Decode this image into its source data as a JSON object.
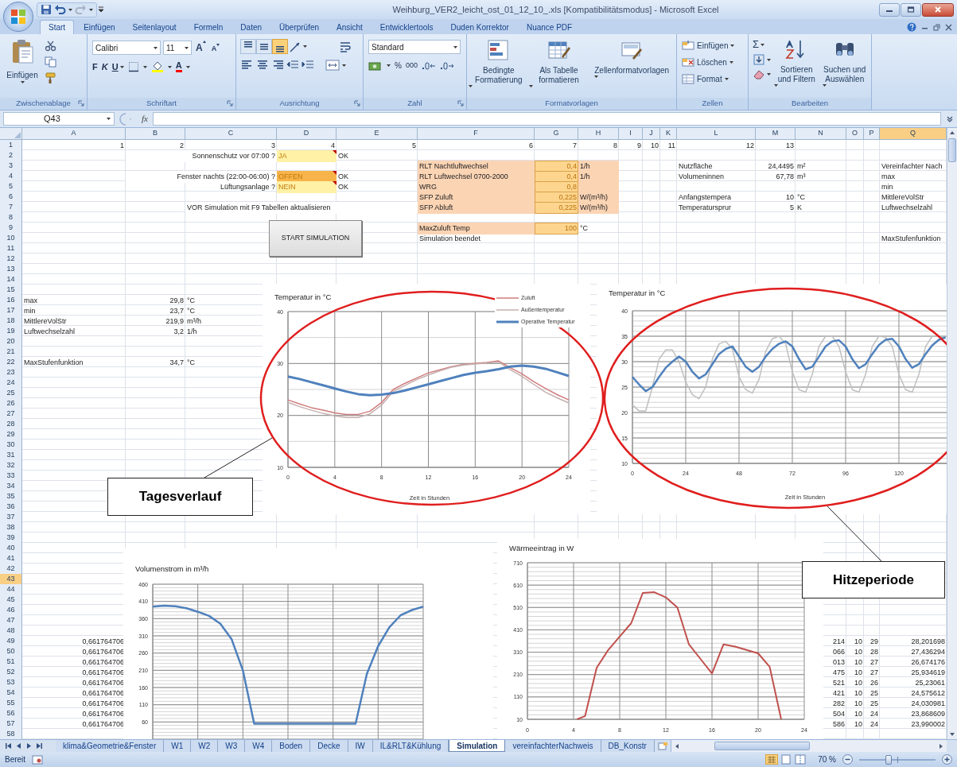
{
  "window": {
    "title": "Weihburg_VER2_leicht_ost_01_12_10_.xls  [Kompatibilitätsmodus] - Microsoft Excel"
  },
  "ribbon_tabs": [
    {
      "label": "Start",
      "selected": true
    },
    {
      "label": "Einfügen",
      "selected": false
    },
    {
      "label": "Seitenlayout",
      "selected": false
    },
    {
      "label": "Formeln",
      "selected": false
    },
    {
      "label": "Daten",
      "selected": false
    },
    {
      "label": "Überprüfen",
      "selected": false
    },
    {
      "label": "Ansicht",
      "selected": false
    },
    {
      "label": "Entwicklertools",
      "selected": false
    },
    {
      "label": "Duden Korrektor",
      "selected": false
    },
    {
      "label": "Nuance PDF",
      "selected": false
    }
  ],
  "ribbon": {
    "clipboard": {
      "label": "Zwischenablage",
      "paste": "Einfügen"
    },
    "font": {
      "label": "Schriftart",
      "font_name": "Calibri",
      "font_size": "11",
      "grow": "A",
      "shrink": "A",
      "bold": "F",
      "italic": "K",
      "underline": "U",
      "color_letter": "A"
    },
    "alignment": {
      "label": "Ausrichtung",
      "vertical": [
        {
          "kind": "top",
          "on": false
        },
        {
          "kind": "middle",
          "on": false
        },
        {
          "kind": "bottom",
          "on": true
        }
      ]
    },
    "number": {
      "label": "Zahl",
      "format": "Standard",
      "percent": "%",
      "thousands": "000"
    },
    "styles": {
      "label": "Formatvorlagen",
      "buttons": [
        "Bedingte Formatierung",
        "Als Tabelle formatieren",
        "Zellenformatvorlagen"
      ]
    },
    "cells": {
      "label": "Zellen",
      "buttons": [
        "Einfügen",
        "Löschen",
        "Format"
      ]
    },
    "editing": {
      "label": "Bearbeiten",
      "sum": "Σ",
      "buttons": [
        "Sortieren und Filtern",
        "Suchen und Auswählen"
      ]
    }
  },
  "formula_bar": {
    "name_box": "Q43",
    "fx": "fx"
  },
  "columns": [
    {
      "label": "A",
      "selected": false
    },
    {
      "label": "B",
      "selected": false
    },
    {
      "label": "C",
      "selected": false
    },
    {
      "label": "D",
      "selected": false
    },
    {
      "label": "E",
      "selected": false
    },
    {
      "label": "F",
      "selected": false
    },
    {
      "label": "G",
      "selected": false
    },
    {
      "label": "H",
      "selected": false
    },
    {
      "label": "I",
      "selected": false
    },
    {
      "label": "J",
      "selected": false
    },
    {
      "label": "K",
      "selected": false
    },
    {
      "label": "L",
      "selected": false
    },
    {
      "label": "M",
      "selected": false
    },
    {
      "label": "N",
      "selected": false
    },
    {
      "label": "O",
      "selected": false
    },
    {
      "label": "P",
      "selected": false
    },
    {
      "label": "Q",
      "selected": true
    }
  ],
  "rows": [
    {
      "number": "1",
      "selected": false,
      "cells": {
        "A": {
          "text": "1",
          "kind": "number"
        },
        "B": {
          "text": "2",
          "kind": "number"
        },
        "C": {
          "text": "3",
          "kind": "number"
        },
        "D": {
          "text": "4",
          "kind": "number"
        },
        "E": {
          "text": "5",
          "kind": "number"
        },
        "F": {
          "text": "6",
          "kind": "number"
        },
        "G": {
          "text": "7",
          "kind": "number"
        },
        "H": {
          "text": "8",
          "kind": "number"
        },
        "I": {
          "text": "9",
          "kind": "number"
        },
        "J": {
          "text": "10",
          "kind": "number"
        },
        "K": {
          "text": "11",
          "kind": "number"
        },
        "L": {
          "text": "12",
          "kind": "number"
        },
        "M": {
          "text": "13",
          "kind": "number"
        }
      }
    },
    {
      "number": "2",
      "selected": false,
      "cells": {
        "C": {
          "text": "Sonnenschutz vor 07:00 ?",
          "kind": "label"
        },
        "D": {
          "text": "JA",
          "kind": "choice",
          "color": "#fff1a6"
        },
        "E": {
          "text": "OK",
          "kind": "text"
        }
      }
    },
    {
      "number": "3",
      "selected": false,
      "cells": {
        "F": {
          "text": "RLT Nachtluftwechsel",
          "kind": "param"
        },
        "G": {
          "text": "0,4",
          "kind": "value"
        },
        "H": {
          "text": "1/h",
          "kind": "param"
        },
        "L": {
          "text": "Nutzfläche",
          "kind": "text"
        },
        "M": {
          "text": "24,4495",
          "kind": "number"
        },
        "N": {
          "text": "m²",
          "kind": "text"
        },
        "Q": {
          "text": "Vereinfachter Nach",
          "kind": "text"
        }
      }
    },
    {
      "number": "4",
      "selected": false,
      "cells": {
        "C": {
          "text": "Fenster nachts (22:00-06:00) ?",
          "kind": "label"
        },
        "D": {
          "text": "OFFEN",
          "kind": "choice",
          "color": "#f7b44a"
        },
        "E": {
          "text": "OK",
          "kind": "text"
        },
        "F": {
          "text": "RLT Luftwechsel 0700-2000",
          "kind": "param"
        },
        "G": {
          "text": "0,4",
          "kind": "value"
        },
        "H": {
          "text": "1/h",
          "kind": "param"
        },
        "L": {
          "text": "Volumeninnen",
          "kind": "text"
        },
        "M": {
          "text": "67,78",
          "kind": "number"
        },
        "N": {
          "text": "m³",
          "kind": "text"
        },
        "Q": {
          "text": "max",
          "kind": "text"
        }
      }
    },
    {
      "number": "5",
      "selected": false,
      "cells": {
        "C": {
          "text": "Lüftungsanlage ?",
          "kind": "label"
        },
        "D": {
          "text": "NEIN",
          "kind": "choice",
          "color": "#fff1a6"
        },
        "E": {
          "text": "OK",
          "kind": "text"
        },
        "F": {
          "text": "WRG",
          "kind": "param"
        },
        "G": {
          "text": "0,8",
          "kind": "value"
        },
        "H": {
          "kind": "param"
        },
        "Q": {
          "text": "min",
          "kind": "text"
        }
      }
    },
    {
      "number": "6",
      "selected": false,
      "cells": {
        "F": {
          "text": "SFP Zuluft",
          "kind": "param"
        },
        "G": {
          "text": "0,225",
          "kind": "value"
        },
        "H": {
          "text": "W/(m³/h)",
          "kind": "param"
        },
        "L": {
          "text": "Anfangstempera",
          "kind": "text"
        },
        "M": {
          "text": "10",
          "kind": "number"
        },
        "N": {
          "text": "°C",
          "kind": "text"
        },
        "Q": {
          "text": "MittlereVolStr",
          "kind": "text"
        }
      }
    },
    {
      "number": "7",
      "selected": false,
      "cells": {
        "C": {
          "text": "VOR Simulation mit F9 Tabellen aktualisieren",
          "kind": "text"
        },
        "F": {
          "text": "SFP Abluft",
          "kind": "param"
        },
        "G": {
          "text": "0,225",
          "kind": "value"
        },
        "H": {
          "text": "W/(m³/h)",
          "kind": "param"
        },
        "L": {
          "text": "Temperatursprur",
          "kind": "text"
        },
        "M": {
          "text": "5",
          "kind": "number"
        },
        "N": {
          "text": "K",
          "kind": "text"
        },
        "Q": {
          "text": "Luftwechselzahl",
          "kind": "text"
        }
      }
    },
    {
      "number": "8",
      "selected": false
    },
    {
      "number": "9",
      "selected": false,
      "cells": {
        "F": {
          "text": "MaxZuluft Temp",
          "kind": "param"
        },
        "G": {
          "text": "100",
          "kind": "value"
        },
        "H": {
          "text": "°C",
          "kind": "text"
        }
      }
    },
    {
      "number": "10",
      "selected": false,
      "cells": {
        "F": {
          "text": "Simulation beendet",
          "kind": "text"
        },
        "Q": {
          "text": "MaxStufenfunktion",
          "kind": "text"
        }
      }
    },
    {
      "number": "11",
      "selected": false
    },
    {
      "number": "12",
      "selected": false
    },
    {
      "number": "13",
      "selected": false
    },
    {
      "number": "14",
      "selected": false
    },
    {
      "number": "15",
      "selected": false
    },
    {
      "number": "16",
      "selected": false,
      "cells": {
        "A": {
          "text": "max",
          "kind": "text"
        },
        "B": {
          "text": "29,8",
          "kind": "number"
        },
        "C": {
          "text": "°C",
          "kind": "text"
        }
      }
    },
    {
      "number": "17",
      "selected": false,
      "cells": {
        "A": {
          "text": "min",
          "kind": "text"
        },
        "B": {
          "text": "23,7",
          "kind": "number"
        },
        "C": {
          "text": "°C",
          "kind": "text"
        }
      }
    },
    {
      "number": "18",
      "selected": false,
      "cells": {
        "A": {
          "text": "MittlereVolStr",
          "kind": "text"
        },
        "B": {
          "text": "219,9",
          "kind": "number"
        },
        "C": {
          "text": "m³/h",
          "kind": "text"
        }
      }
    },
    {
      "number": "19",
      "selected": false,
      "cells": {
        "A": {
          "text": "Luftwechselzahl",
          "kind": "text"
        },
        "B": {
          "text": "3,2",
          "kind": "number"
        },
        "C": {
          "text": "1/h",
          "kind": "text"
        }
      }
    },
    {
      "number": "20",
      "selected": false
    },
    {
      "number": "21",
      "selected": false
    },
    {
      "number": "22",
      "selected": false,
      "cells": {
        "A": {
          "text": "MaxStufenfunktion",
          "kind": "text"
        },
        "B": {
          "text": "34,7",
          "kind": "number"
        },
        "C": {
          "text": "°C",
          "kind": "text"
        }
      }
    },
    {
      "number": "23",
      "selected": false
    },
    {
      "number": "24",
      "selected": false
    },
    {
      "number": "25",
      "selected": false
    },
    {
      "number": "26",
      "selected": false
    },
    {
      "number": "27",
      "selected": false
    },
    {
      "number": "28",
      "selected": false
    },
    {
      "number": "29",
      "selected": false
    },
    {
      "number": "30",
      "selected": false
    },
    {
      "number": "31",
      "selected": false
    },
    {
      "number": "32",
      "selected": false
    },
    {
      "number": "33",
      "selected": false
    },
    {
      "number": "34",
      "selected": false
    },
    {
      "number": "35",
      "selected": false
    },
    {
      "number": "36",
      "selected": false
    },
    {
      "number": "37",
      "selected": false
    },
    {
      "number": "38",
      "selected": false
    },
    {
      "number": "39",
      "selected": false
    },
    {
      "number": "40",
      "selected": false
    },
    {
      "number": "41",
      "selected": false
    },
    {
      "number": "42",
      "selected": false
    },
    {
      "number": "43",
      "selected": true
    },
    {
      "number": "44",
      "selected": false
    },
    {
      "number": "45",
      "selected": false
    },
    {
      "number": "46",
      "selected": false
    },
    {
      "number": "47",
      "selected": false
    },
    {
      "number": "48",
      "selected": false
    },
    {
      "number": "49",
      "selected": false,
      "cells": {
        "A": {
          "text": "0,661764706",
          "kind": "number"
        },
        "N": {
          "text": "214",
          "kind": "number"
        },
        "O": {
          "text": "10",
          "kind": "number"
        },
        "P": {
          "text": "29",
          "kind": "number"
        },
        "Q": {
          "text": "28,201698",
          "kind": "number"
        }
      }
    },
    {
      "number": "50",
      "selected": false,
      "cells": {
        "A": {
          "text": "0,661764706",
          "kind": "number"
        },
        "N": {
          "text": "066",
          "kind": "number"
        },
        "O": {
          "text": "10",
          "kind": "number"
        },
        "P": {
          "text": "28",
          "kind": "number"
        },
        "Q": {
          "text": "27,436294",
          "kind": "number"
        }
      }
    },
    {
      "number": "51",
      "selected": false,
      "cells": {
        "A": {
          "text": "0,661764706",
          "kind": "number"
        },
        "N": {
          "text": "013",
          "kind": "number"
        },
        "O": {
          "text": "10",
          "kind": "number"
        },
        "P": {
          "text": "27",
          "kind": "number"
        },
        "Q": {
          "text": "26,674176",
          "kind": "number"
        }
      }
    },
    {
      "number": "52",
      "selected": false,
      "cells": {
        "A": {
          "text": "0,661764706",
          "kind": "number"
        },
        "N": {
          "text": "475",
          "kind": "number"
        },
        "O": {
          "text": "10",
          "kind": "number"
        },
        "P": {
          "text": "27",
          "kind": "number"
        },
        "Q": {
          "text": "25,934619",
          "kind": "number"
        }
      }
    },
    {
      "number": "53",
      "selected": false,
      "cells": {
        "A": {
          "text": "0,661764706",
          "kind": "number"
        },
        "N": {
          "text": "521",
          "kind": "number"
        },
        "O": {
          "text": "10",
          "kind": "number"
        },
        "P": {
          "text": "26",
          "kind": "number"
        },
        "Q": {
          "text": "25,23061",
          "kind": "number"
        }
      }
    },
    {
      "number": "54",
      "selected": false,
      "cells": {
        "A": {
          "text": "0,661764706",
          "kind": "number"
        },
        "N": {
          "text": "421",
          "kind": "number"
        },
        "O": {
          "text": "10",
          "kind": "number"
        },
        "P": {
          "text": "25",
          "kind": "number"
        },
        "Q": {
          "text": "24,575612",
          "kind": "number"
        }
      }
    },
    {
      "number": "55",
      "selected": false,
      "cells": {
        "A": {
          "text": "0,661764706",
          "kind": "number"
        },
        "N": {
          "text": "282",
          "kind": "number"
        },
        "O": {
          "text": "10",
          "kind": "number"
        },
        "P": {
          "text": "25",
          "kind": "number"
        },
        "Q": {
          "text": "24,030981",
          "kind": "number"
        }
      }
    },
    {
      "number": "56",
      "selected": false,
      "cells": {
        "A": {
          "text": "0,661764706",
          "kind": "number"
        },
        "N": {
          "text": "504",
          "kind": "number"
        },
        "O": {
          "text": "10",
          "kind": "number"
        },
        "P": {
          "text": "24",
          "kind": "number"
        },
        "Q": {
          "text": "23,868609",
          "kind": "number"
        }
      }
    },
    {
      "number": "57",
      "selected": false,
      "cells": {
        "A": {
          "text": "0,661764706",
          "kind": "number"
        },
        "N": {
          "text": "586",
          "kind": "number"
        },
        "O": {
          "text": "10",
          "kind": "number"
        },
        "P": {
          "text": "24",
          "kind": "number"
        },
        "Q": {
          "text": "23,990002",
          "kind": "number"
        }
      }
    },
    {
      "number": "58",
      "selected": false
    }
  ],
  "button": {
    "label": "START SIMULATION"
  },
  "charts": [
    {
      "chart_data": {
        "type": "line",
        "title": "Temperatur in °C",
        "xlabel": "Zeit in Stunden",
        "grid": true,
        "legend": true,
        "x": [
          0,
          1,
          2,
          3,
          4,
          5,
          6,
          7,
          8,
          9,
          10,
          11,
          12,
          13,
          14,
          15,
          16,
          17,
          18,
          19,
          20,
          21,
          22,
          23,
          24
        ],
        "xlim": [
          0,
          24
        ],
        "ylim": [
          10,
          40
        ],
        "xticks": [
          {
            "value": 0,
            "label": "0"
          },
          {
            "value": 4,
            "label": "4"
          },
          {
            "value": 8,
            "label": "8"
          },
          {
            "value": 12,
            "label": "12"
          },
          {
            "value": 16,
            "label": "16"
          },
          {
            "value": 20,
            "label": "20"
          },
          {
            "value": 24,
            "label": "24"
          }
        ],
        "yticks": [
          {
            "value": 10,
            "label": "10"
          },
          {
            "value": 20,
            "label": "20"
          },
          {
            "value": 30,
            "label": "30"
          },
          {
            "value": 40,
            "label": "40"
          }
        ],
        "series": [
          {
            "name": "Zuluft",
            "color": "#d07c7c",
            "values": [
              23,
              22.2,
              21.5,
              21,
              20.5,
              20.2,
              20.2,
              20.8,
              22.5,
              25,
              26.2,
              27.2,
              28.2,
              28.8,
              29.4,
              29.8,
              30,
              30.2,
              30.5,
              29.2,
              28,
              26.5,
              25.2,
              24,
              23
            ]
          },
          {
            "name": "Außentemperatur",
            "color": "#c6b0b0",
            "values": [
              22.5,
              21.7,
              21,
              20.4,
              19.9,
              19.6,
              19.6,
              20.3,
              22,
              24.6,
              25.8,
              26.9,
              27.8,
              28.6,
              29.3,
              29.7,
              29.9,
              30.1,
              30.3,
              28.8,
              27.5,
              26,
              24.5,
              23.4,
              22.4
            ]
          },
          {
            "name": "Operative Temperatur",
            "color": "#4f81bd",
            "values": [
              27.5,
              27,
              26.4,
              25.8,
              25.2,
              24.6,
              24.1,
              23.9,
              24,
              24.3,
              24.8,
              25.4,
              26,
              26.6,
              27.2,
              27.8,
              28.2,
              28.5,
              28.9,
              29.4,
              29.6,
              29.4,
              29,
              28.3,
              27.6
            ]
          }
        ]
      }
    },
    {
      "chart_data": {
        "type": "line",
        "title": "Temperatur in °C",
        "xlabel": "Zeit in Stunden",
        "grid": true,
        "x": [
          0,
          3,
          6,
          9,
          12,
          15,
          18,
          21,
          24,
          27,
          30,
          33,
          36,
          39,
          42,
          45,
          48,
          51,
          54,
          57,
          60,
          63,
          66,
          69,
          72,
          75,
          78,
          81,
          84,
          87,
          90,
          93,
          96,
          99,
          102,
          105,
          108,
          111,
          114,
          117,
          120,
          123,
          126,
          129,
          132,
          135,
          138,
          141
        ],
        "xlim": [
          0,
          141.5
        ],
        "ylim": [
          10,
          40
        ],
        "xticks": [
          {
            "value": 0,
            "label": "0"
          },
          {
            "value": 24,
            "label": "24"
          },
          {
            "value": 48,
            "label": "48"
          },
          {
            "value": 72,
            "label": "72"
          },
          {
            "value": 96,
            "label": "96"
          },
          {
            "value": 120,
            "label": "120"
          }
        ],
        "yticks": [
          {
            "value": 10,
            "label": "10"
          },
          {
            "value": 15,
            "label": "15"
          },
          {
            "value": 20,
            "label": "20"
          },
          {
            "value": 25,
            "label": "25"
          },
          {
            "value": 30,
            "label": "30"
          },
          {
            "value": 35,
            "label": "35"
          },
          {
            "value": 40,
            "label": "40"
          }
        ],
        "series": [
          {
            "color": "#bfbfbf",
            "values": [
              21.5,
              20.3,
              20.3,
              25,
              30.5,
              32.3,
              32.3,
              30,
              26,
              23.5,
              22.7,
              25,
              30.5,
              33.5,
              34,
              32.5,
              27,
              24.5,
              23.8,
              26.5,
              32,
              34.5,
              35,
              33.5,
              28,
              24.5,
              24,
              27.5,
              33,
              35,
              35,
              33,
              28,
              24.5,
              24,
              27.5,
              33,
              35,
              34.8,
              33,
              27.5,
              24.5,
              24,
              27.5,
              33,
              35,
              35,
              34.5
            ]
          },
          {
            "color": "#4f81bd",
            "values": [
              27,
              25.5,
              24.2,
              25,
              27,
              28.8,
              30,
              31,
              30,
              28,
              26.7,
              27.5,
              29.5,
              31.5,
              32.5,
              33,
              31,
              29,
              28,
              29,
              31,
              32.5,
              33.5,
              34,
              33,
              30.5,
              28.5,
              29,
              31,
              33,
              34,
              34.2,
              33,
              30.5,
              28.7,
              29.5,
              31.5,
              33.3,
              34.3,
              34.5,
              33,
              30.5,
              28.8,
              29.5,
              31.5,
              33.2,
              34.3,
              34.8
            ]
          }
        ]
      }
    },
    {
      "chart_data": {
        "type": "line",
        "title": "Volumenstrom in m³/h",
        "grid": true,
        "categories": [
          null,
          null,
          null,
          null,
          null,
          null,
          null,
          null,
          null,
          null,
          null,
          null,
          null,
          null,
          null,
          null,
          null,
          null,
          null,
          null,
          null,
          null,
          null,
          null,
          null
        ],
        "ylim": [
          10,
          460
        ],
        "yticks": [
          {
            "value": 60,
            "label": "60"
          },
          {
            "value": 110,
            "label": "110"
          },
          {
            "value": 160,
            "label": "160"
          },
          {
            "value": 210,
            "label": "210"
          },
          {
            "value": 260,
            "label": "260"
          },
          {
            "value": 310,
            "label": "310"
          },
          {
            "value": 360,
            "label": "360"
          },
          {
            "value": 410,
            "label": "410"
          },
          {
            "value": 460,
            "label": "460"
          }
        ],
        "series": [
          {
            "color": "#4f81bd",
            "values": [
              395,
              398,
              396,
              390,
              380,
              368,
              345,
              300,
              210,
              55,
              55,
              55,
              55,
              55,
              55,
              55,
              55,
              55,
              55,
              200,
              280,
              335,
              370,
              385,
              395
            ]
          }
        ]
      }
    },
    {
      "chart_data": {
        "type": "line",
        "title": "Wärmeeintrag in W",
        "grid": true,
        "x": [
          4.3,
          5,
          6,
          7,
          8,
          9,
          10,
          11,
          12,
          13,
          14,
          15,
          16,
          17,
          18,
          19,
          20,
          21,
          22
        ],
        "xlim": [
          0,
          24
        ],
        "ylim": [
          10,
          710
        ],
        "xticks": [
          {
            "value": 0,
            "label": "0"
          },
          {
            "value": 4,
            "label": "4"
          },
          {
            "value": 8,
            "label": "8"
          },
          {
            "value": 12,
            "label": "12"
          },
          {
            "value": 16,
            "label": "16"
          },
          {
            "value": 20,
            "label": "20"
          },
          {
            "value": 24,
            "label": "24"
          }
        ],
        "yticks": [
          {
            "value": 10,
            "label": "10"
          },
          {
            "value": 110,
            "label": "110"
          },
          {
            "value": 210,
            "label": "210"
          },
          {
            "value": 310,
            "label": "310"
          },
          {
            "value": 410,
            "label": "410"
          },
          {
            "value": 510,
            "label": "510"
          },
          {
            "value": 610,
            "label": "610"
          },
          {
            "value": 710,
            "label": "710"
          }
        ],
        "series": [
          {
            "color": "#c0504d",
            "values": [
              10,
              25,
              240,
              320,
              380,
              440,
              575,
              578,
              555,
              510,
              345,
              280,
              215,
              345,
              335,
              320,
              305,
              245,
              10
            ]
          }
        ]
      }
    }
  ],
  "callouts": [
    "Tagesverlauf",
    "Hitzeperiode"
  ],
  "sheet_tabs": [
    {
      "label": "klima&Geometrie&Fenster",
      "selected": false
    },
    {
      "label": "W1",
      "selected": false
    },
    {
      "label": "W2",
      "selected": false
    },
    {
      "label": "W3",
      "selected": false
    },
    {
      "label": "W4",
      "selected": false
    },
    {
      "label": "Boden",
      "selected": false
    },
    {
      "label": "Decke",
      "selected": false
    },
    {
      "label": "IW",
      "selected": false
    },
    {
      "label": "IL&RLT&Kühlung",
      "selected": false
    },
    {
      "label": "Simulation",
      "selected": true
    },
    {
      "label": "vereinfachterNachweis",
      "selected": false
    },
    {
      "label": "DB_Konstr",
      "selected": false
    }
  ],
  "status_bar": {
    "text": "Bereit",
    "zoom": "70 %",
    "zoom_slider": {
      "level": 0.39
    }
  }
}
